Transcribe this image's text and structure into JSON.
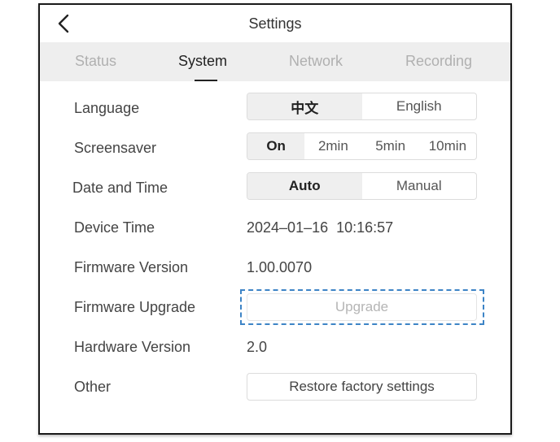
{
  "header": {
    "title": "Settings",
    "back_icon": "chevron-left-icon"
  },
  "tabs": [
    {
      "label": "Status",
      "active": false
    },
    {
      "label": "System",
      "active": true
    },
    {
      "label": "Network",
      "active": false
    },
    {
      "label": "Recording",
      "active": false
    }
  ],
  "settings": {
    "language": {
      "label": "Language",
      "options": [
        "中文",
        "English"
      ],
      "selected": "中文"
    },
    "screensaver": {
      "label": "Screensaver",
      "options": [
        "On",
        "2min",
        "5min",
        "10min"
      ],
      "selected": "On"
    },
    "date_time": {
      "label": "Date and Time",
      "options": [
        "Auto",
        "Manual"
      ],
      "selected": "Auto"
    },
    "device_time": {
      "label": "Device Time",
      "value": "2024–01–16  10:16:57"
    },
    "firmware_version": {
      "label": "Firmware Version",
      "value": "1.00.0070"
    },
    "firmware_upgrade": {
      "label": "Firmware Upgrade",
      "button": "Upgrade"
    },
    "hardware_version": {
      "label": "Hardware Version",
      "value": "2.0"
    },
    "other": {
      "label": "Other",
      "button": "Restore factory settings"
    }
  },
  "colors": {
    "highlight": "#3d84c6",
    "tab_bar": "#eeeeee",
    "selected_segment": "#efefef"
  }
}
